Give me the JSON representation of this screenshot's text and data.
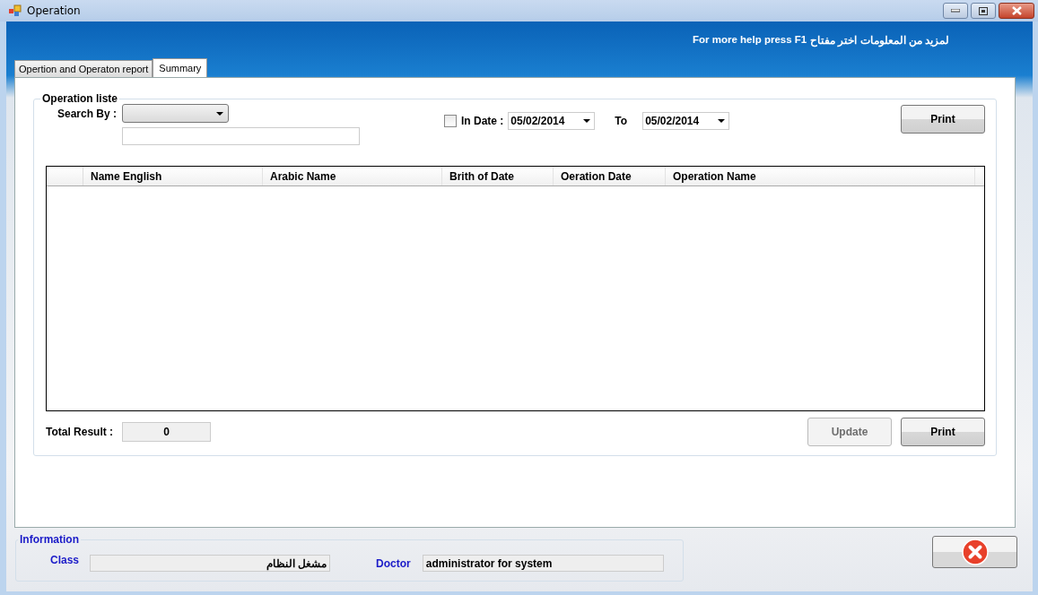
{
  "window": {
    "title": "Operation"
  },
  "help": {
    "english": "For more help press F1",
    "arabic": "لمزيد من المعلومات اختر مفتاح"
  },
  "tabs": [
    {
      "label": "Opertion and Operaton report",
      "selected": false
    },
    {
      "label": "Summary",
      "selected": true
    }
  ],
  "operation_group": {
    "title": "Operation liste",
    "search_by_label": "Search By :",
    "in_date": {
      "label": "In Date :",
      "checked": false
    },
    "date_from": "05/02/2014",
    "to_label": "To",
    "date_to": "05/02/2014",
    "print_button": "Print"
  },
  "table": {
    "columns": [
      "Name English",
      "Arabic Name",
      "Brith of Date",
      "Oeration Date",
      "Operation Name"
    ]
  },
  "total": {
    "label": "Total Result :",
    "value": "0"
  },
  "buttons": [
    {
      "label": "Update",
      "disabled": true
    },
    {
      "label": "Print",
      "disabled": false
    }
  ],
  "information": {
    "title": "Information",
    "class_label": "Class",
    "class_value": "مشغل النظام",
    "doctor_label": "Doctor",
    "doctor_value": "administrator for system"
  }
}
